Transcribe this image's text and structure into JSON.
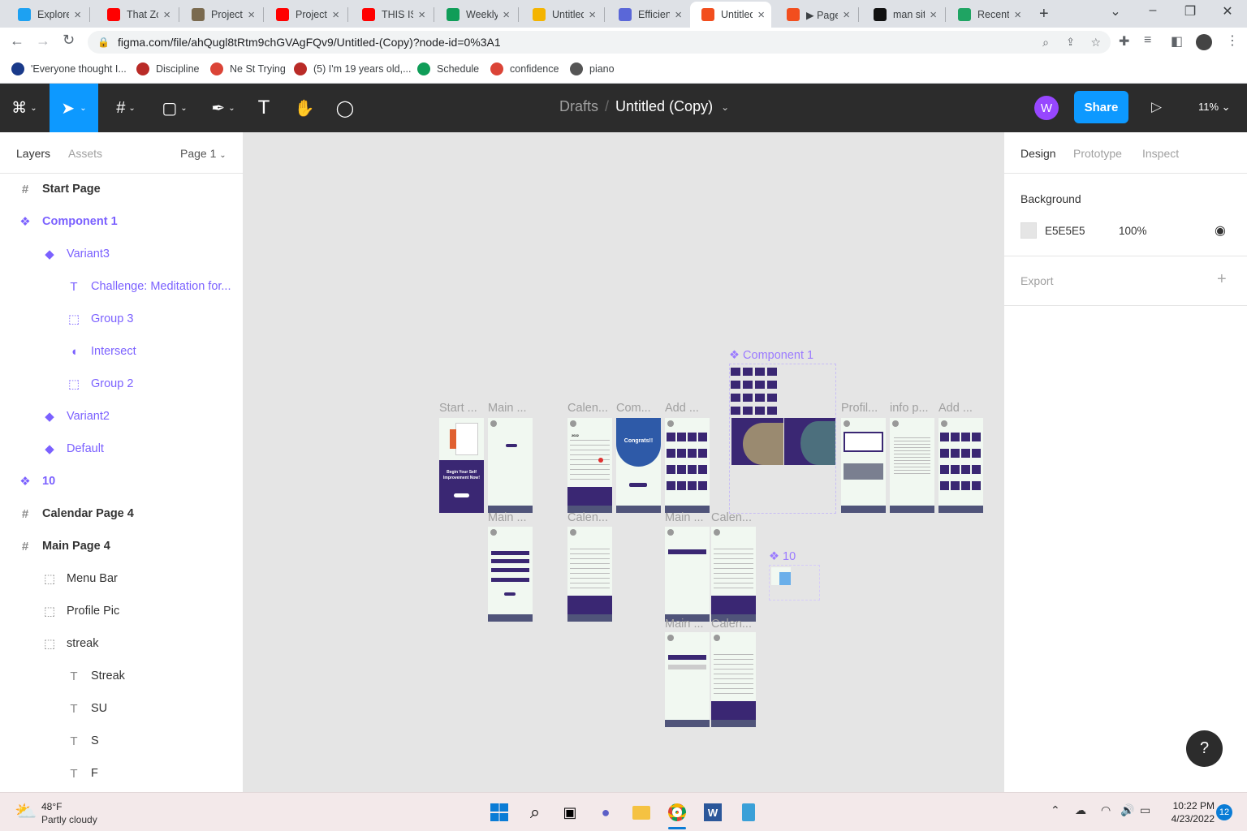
{
  "browser": {
    "tabs": [
      {
        "title": "Explore",
        "favicon": "twitter-icon",
        "color": "#1da1f2"
      },
      {
        "title": "That Zo",
        "favicon": "youtube-icon",
        "color": "#ff0000"
      },
      {
        "title": "Project",
        "favicon": "project-icon",
        "color": "#7a6a4f"
      },
      {
        "title": "Project",
        "favicon": "youtube-icon",
        "color": "#ff0000"
      },
      {
        "title": "THIS IS",
        "favicon": "youtube-icon",
        "color": "#ff0000"
      },
      {
        "title": "Weekly",
        "favicon": "sheets-icon",
        "color": "#0f9d58"
      },
      {
        "title": "Untitled",
        "favicon": "slides-icon",
        "color": "#f4b400"
      },
      {
        "title": "Efficient",
        "favicon": "docs-icon",
        "color": "#5a67d8"
      },
      {
        "title": "Untitled",
        "favicon": "figma-icon",
        "color": "#f24e1e"
      },
      {
        "title": "▶ Page",
        "favicon": "figma-icon",
        "color": "#f24e1e"
      },
      {
        "title": "man sit",
        "favicon": "unsplash-icon",
        "color": "#111111"
      },
      {
        "title": "Recent",
        "favicon": "drive-icon",
        "color": "#1fa463"
      }
    ],
    "new_tab": "+",
    "url": "figma.com/file/ahQugl8tRtm9chGVAgFQv9/Untitled-(Copy)?node-id=0%3A1",
    "bookmarks": [
      {
        "label": "'Everyone thought I...",
        "favicon": "site-icon",
        "color": "#1a3a8a"
      },
      {
        "label": "Discipline",
        "favicon": "quora-icon",
        "color": "#b92b27"
      },
      {
        "label": "Ne St Trying",
        "favicon": "chrome-icon",
        "color": "#db4437"
      },
      {
        "label": "(5) I'm 19 years old,...",
        "favicon": "quora-icon",
        "color": "#b92b27"
      },
      {
        "label": "Schedule",
        "favicon": "sheets-icon",
        "color": "#0f9d58"
      },
      {
        "label": "confidence",
        "favicon": "chrome-icon",
        "color": "#db4437"
      },
      {
        "label": "piano",
        "favicon": "globe-icon",
        "color": "#555555"
      }
    ]
  },
  "figma": {
    "breadcrumb_parent": "Drafts",
    "breadcrumb_sep": "/",
    "file_title": "Untitled (Copy)",
    "avatar_letter": "W",
    "share_label": "Share",
    "zoom": "11%",
    "left_tabs": {
      "layers": "Layers",
      "assets": "Assets",
      "page": "Page 1"
    },
    "layers": [
      {
        "label": "Start Page",
        "icon": "#",
        "indent": 0,
        "style": "frame"
      },
      {
        "label": "Component 1",
        "icon": "❖",
        "indent": 0,
        "style": "component"
      },
      {
        "label": "Variant3",
        "icon": "◆",
        "indent": 1,
        "style": "component"
      },
      {
        "label": "Challenge: Meditation for...",
        "icon": "T",
        "indent": 2,
        "style": "component"
      },
      {
        "label": "Group 3",
        "icon": "⬚",
        "indent": 2,
        "style": "component"
      },
      {
        "label": "Intersect",
        "icon": "◖",
        "indent": 2,
        "style": "component"
      },
      {
        "label": "Group 2",
        "icon": "⬚",
        "indent": 2,
        "style": "component"
      },
      {
        "label": "Variant2",
        "icon": "◆",
        "indent": 1,
        "style": "component"
      },
      {
        "label": "Default",
        "icon": "◆",
        "indent": 1,
        "style": "component"
      },
      {
        "label": "10",
        "icon": "❖",
        "indent": 0,
        "style": "component"
      },
      {
        "label": "Calendar Page 4",
        "icon": "#",
        "indent": 0,
        "style": "frame"
      },
      {
        "label": "Main Page 4",
        "icon": "#",
        "indent": 0,
        "style": "frame"
      },
      {
        "label": "Menu Bar",
        "icon": "⬚",
        "indent": 1,
        "style": "normal"
      },
      {
        "label": "Profile Pic",
        "icon": "⬚",
        "indent": 1,
        "style": "normal"
      },
      {
        "label": "streak",
        "icon": "⬚",
        "indent": 1,
        "style": "normal"
      },
      {
        "label": "Streak",
        "icon": "T",
        "indent": 2,
        "style": "normal"
      },
      {
        "label": "SU",
        "icon": "T",
        "indent": 2,
        "style": "normal"
      },
      {
        "label": "S",
        "icon": "T",
        "indent": 2,
        "style": "normal"
      },
      {
        "label": "F",
        "icon": "T",
        "indent": 2,
        "style": "normal"
      }
    ],
    "right_tabs": {
      "design": "Design",
      "prototype": "Prototype",
      "inspect": "Inspect"
    },
    "background": {
      "heading": "Background",
      "hex": "E5E5E5",
      "opacity": "100%",
      "swatch": "#e5e5e5"
    },
    "export": {
      "heading": "Export",
      "add": "+"
    },
    "canvas_labels": {
      "start": "Start ...",
      "main1": "Main ...",
      "calen1": "Calen...",
      "com": "Com...",
      "add1": "Add ...",
      "component1": "Component 1",
      "profil": "Profil...",
      "info": "info p...",
      "add2": "Add ...",
      "main2": "Main ...",
      "calen2": "Calen...",
      "main3": "Main ...",
      "calen3": "Calen...",
      "ten": "10",
      "main4": "Main ...",
      "calen4": "Calen..."
    },
    "frame_text": {
      "start_banner": "Begin Your Self Improvement Now!",
      "congrats": "Congrats!!",
      "year": "2022"
    },
    "help": "?"
  },
  "taskbar": {
    "weather_temp": "48°F",
    "weather_desc": "Partly cloudy",
    "time": "10:22 PM",
    "date": "4/23/2022",
    "notif_count": "12"
  }
}
